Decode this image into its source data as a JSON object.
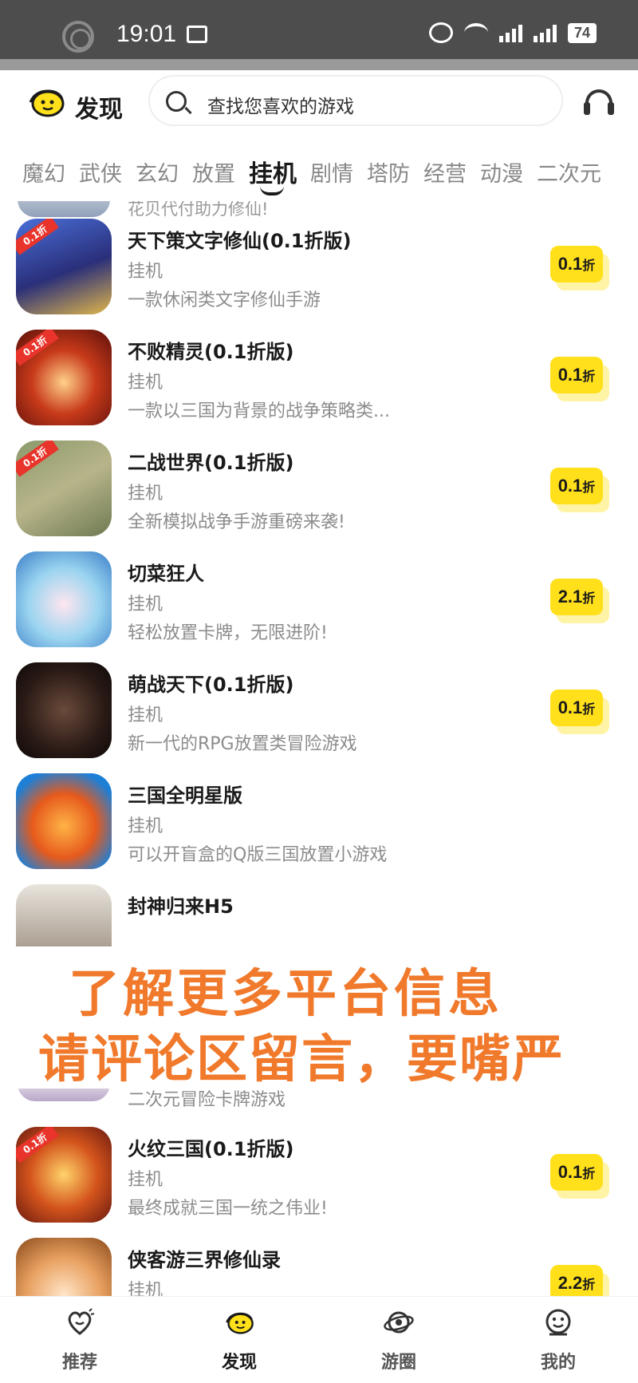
{
  "status_bar": {
    "time": "19:01",
    "battery": "74"
  },
  "header": {
    "title": "发现",
    "search_placeholder": "查找您喜欢的游戏",
    "logo_icon": "smiley-logo-icon",
    "support_icon": "headset-icon"
  },
  "tabs": [
    {
      "label": "魔幻",
      "active": false
    },
    {
      "label": "武侠",
      "active": false
    },
    {
      "label": "玄幻",
      "active": false
    },
    {
      "label": "放置",
      "active": false
    },
    {
      "label": "挂机",
      "active": true
    },
    {
      "label": "剧情",
      "active": false
    },
    {
      "label": "塔防",
      "active": false
    },
    {
      "label": "经营",
      "active": false
    },
    {
      "label": "动漫",
      "active": false
    },
    {
      "label": "二次元",
      "active": false
    }
  ],
  "partial_top_desc": "花贝代付助力修仙!",
  "games": [
    {
      "name": "天下策文字修仙(0.1折版)",
      "category": "挂机",
      "desc": "一款休闲类文字修仙手游",
      "discount": "0.1",
      "discount_unit": "折"
    },
    {
      "name": "不败精灵(0.1折版)",
      "category": "挂机",
      "desc": "一款以三国为背景的战争策略类...",
      "discount": "0.1",
      "discount_unit": "折"
    },
    {
      "name": "二战世界(0.1折版)",
      "category": "挂机",
      "desc": "全新模拟战争手游重磅来袭!",
      "discount": "0.1",
      "discount_unit": "折"
    },
    {
      "name": "切菜狂人",
      "category": "挂机",
      "desc": "轻松放置卡牌，无限进阶!",
      "discount": "2.1",
      "discount_unit": "折"
    },
    {
      "name": "萌战天下(0.1折版)",
      "category": "挂机",
      "desc": "新一代的RPG放置类冒险游戏",
      "discount": "0.1",
      "discount_unit": "折"
    },
    {
      "name": "三国全明星版",
      "category": "挂机",
      "desc": "可以开盲盒的Q版三国放置小游戏",
      "discount": "",
      "discount_unit": ""
    },
    {
      "name": "封神归来H5",
      "category": "",
      "desc": "",
      "discount": "",
      "discount_unit": ""
    }
  ],
  "after_overlay_desc": "二次元冒险卡牌游戏",
  "games_after": [
    {
      "name": "火纹三国(0.1折版)",
      "category": "挂机",
      "desc": "最终成就三国一统之伟业!",
      "discount": "0.1",
      "discount_unit": "折"
    },
    {
      "name": "侠客游三界修仙录",
      "category": "挂机",
      "desc": "",
      "discount": "2.2",
      "discount_unit": "折"
    }
  ],
  "overlay": {
    "line1": "了解更多平台信息",
    "line2": "请评论区留言，要嘴严"
  },
  "bottom_nav": [
    {
      "label": "推荐",
      "icon": "heart-face-icon",
      "active": false
    },
    {
      "label": "发现",
      "icon": "smiley-logo-icon",
      "active": true
    },
    {
      "label": "游圈",
      "icon": "planet-icon",
      "active": false
    },
    {
      "label": "我的",
      "icon": "profile-face-icon",
      "active": false
    }
  ],
  "colors": {
    "accent_yellow": "#ffe01a",
    "overlay_orange": "#f0792b",
    "muted_text": "#8c8c8c"
  }
}
